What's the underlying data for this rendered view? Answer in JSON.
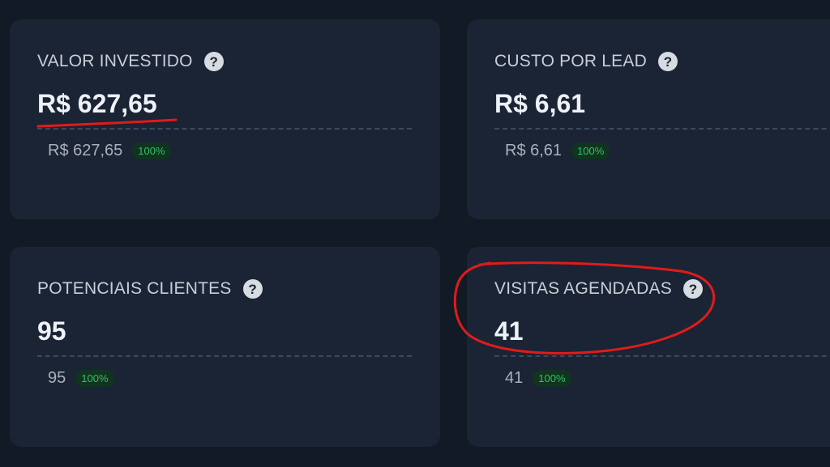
{
  "cards": [
    {
      "title": "VALOR INVESTIDO",
      "value": "R$ 627,65",
      "sub_value": "R$ 627,65",
      "badge": "100%"
    },
    {
      "title": "CUSTO POR LEAD",
      "value": "R$ 6,61",
      "sub_value": "R$ 6,61",
      "badge": "100%"
    },
    {
      "title": "POTENCIAIS CLIENTES",
      "value": "95",
      "sub_value": "95",
      "badge": "100%"
    },
    {
      "title": "VISITAS AGENDADAS",
      "value": "41",
      "sub_value": "41",
      "badge": "100%"
    }
  ],
  "help_icon_glyph": "?",
  "colors": {
    "background": "#121a26",
    "card": "#1a2434",
    "badge_text": "#35c064",
    "annotation": "#e01b1b"
  }
}
